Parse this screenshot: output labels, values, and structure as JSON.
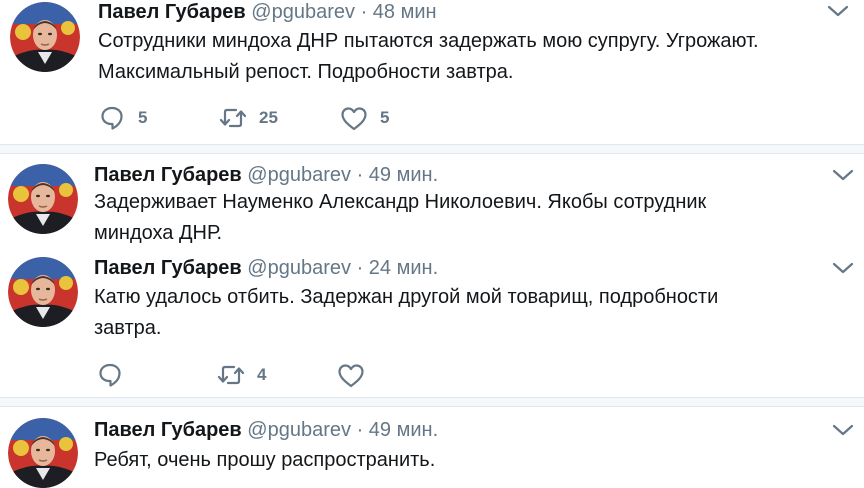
{
  "tweets": [
    {
      "name": "Павел Губарев",
      "handle": "@pgubarev",
      "separator": "·",
      "time": "48 мин",
      "lines": [
        "Сотрудники миндоха ДНР пытаются задержать мою супругу. Угрожают.",
        "Максимальный репост. Подробности завтра."
      ],
      "replies": "5",
      "retweets": "25",
      "likes": "5"
    },
    {
      "name": "Павел Губарев",
      "handle": "@pgubarev",
      "separator": "·",
      "time": "49 мин.",
      "lines": [
        "Задерживает Науменко Александр Николоевич. Якобы сотрудник",
        "миндоха ДНР."
      ]
    },
    {
      "name": "Павел Губарев",
      "handle": "@pgubarev",
      "separator": "·",
      "time": "24 мин.",
      "lines": [
        "Катю удалось отбить. Задержан другой мой товарищ, подробности",
        "завтра."
      ],
      "replies": "",
      "retweets": "4",
      "likes": ""
    },
    {
      "name": "Павел Губарев",
      "handle": "@pgubarev",
      "separator": "·",
      "time": "49 мин.",
      "lines": [
        "Ребят, очень прошу распространить."
      ]
    }
  ],
  "colors": {
    "text": "#14171a",
    "muted": "#657786",
    "divider": "#e1e8ed"
  },
  "icons": {
    "reply": "reply-icon",
    "retweet": "retweet-icon",
    "like": "heart-icon",
    "menu": "chevron-down-icon",
    "avatar": "avatar"
  }
}
